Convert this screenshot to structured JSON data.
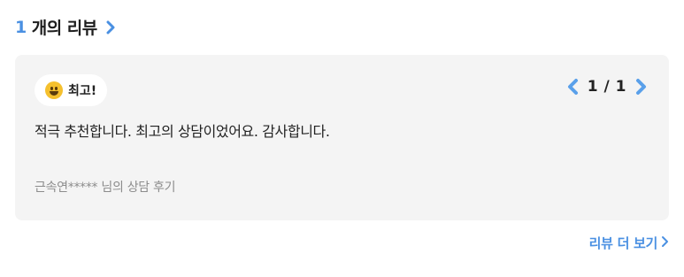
{
  "header": {
    "count": "1",
    "title": "개의 리뷰",
    "chevron_icon": "chevron-right-icon",
    "accent_color": "#4a90e2"
  },
  "review": {
    "rating_icon": "smiling-face-icon",
    "rating_label": "최고!",
    "pager": {
      "text": "1 / 1",
      "prev_icon": "chevron-left-icon",
      "next_icon": "chevron-right-icon"
    },
    "body": "적극 추천합니다. 최고의 상담이었어요. 감사합니다.",
    "author_line": "근속연***** 님의 상담 후기"
  },
  "more": {
    "label": "리뷰 더 보기",
    "icon": "chevron-right-icon"
  }
}
